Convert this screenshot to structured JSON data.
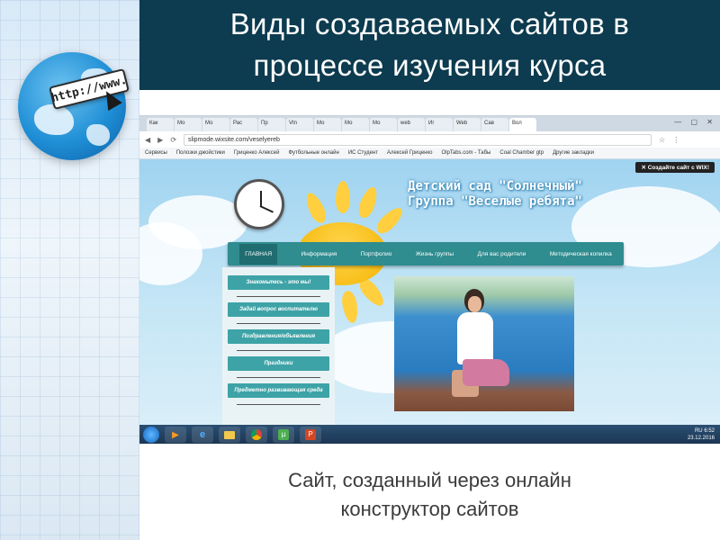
{
  "slide": {
    "title_line1": "Виды создаваемых сайтов в",
    "title_line2": "процессе изучения курса",
    "caption_line1": "Сайт, созданный через онлайн",
    "caption_line2": "конструктор сайтов"
  },
  "logo": {
    "url_text": "http://www.",
    "icon": "globe-icon"
  },
  "browser": {
    "tabs": [
      "Как",
      "Мо",
      "Мо",
      "Рас",
      "Пр",
      "Vtn",
      "Мо",
      "Мо",
      "Мо",
      "web",
      "Иг",
      "Web",
      "Сав",
      "Вол"
    ],
    "active_tab_index": 13,
    "window_controls": "— ▢ ✕",
    "address": "slipmode.wixsite.com/veselyereb",
    "bookmarks": [
      "Сервисы",
      "Полозки джойстики",
      "Гриценко Алексей",
      "Футбольные онлайн",
      "ИС Студент",
      "Алексей Гриценко",
      "OlpTabs.com - Табы",
      "Coal Chamber gtp",
      "Другие закладки"
    ]
  },
  "site": {
    "wix_banner": "✕ Создайте сайт с WIX!",
    "title_line1": "Детский сад \"Солнечный\"",
    "title_line2": "Группа \"Веселые ребята\"",
    "menu": [
      "ГЛАВНАЯ",
      "Информация",
      "Портфолио",
      "Жизнь группы",
      "Для вас родители",
      "Методическая копилка"
    ],
    "side_menu": [
      "Знакомьтесь - это мы!",
      "Задай вопрос воспитателю",
      "Поздравления/объявления",
      "Праздники",
      "Предметно развивающая среда"
    ]
  },
  "taskbar": {
    "apps": [
      "start",
      "media-player",
      "internet-explorer",
      "file-explorer",
      "chrome",
      "utorrent",
      "powerpoint"
    ],
    "lang": "RU",
    "time": "6:52",
    "date": "23.12.2016"
  },
  "colors": {
    "title_bg": "#0d3b4f",
    "menu_teal": "#2f8c8f",
    "caption_text": "#3b3b3b"
  }
}
